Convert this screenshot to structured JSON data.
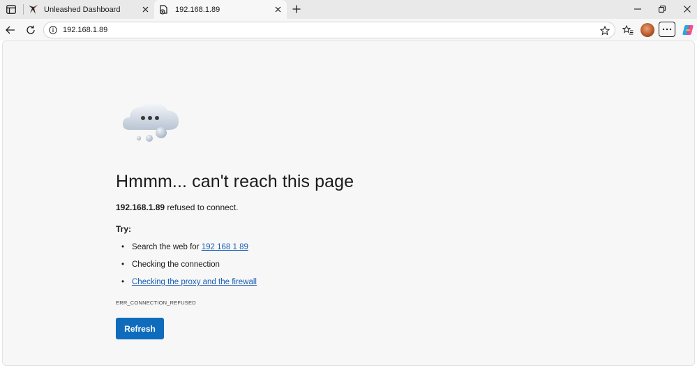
{
  "tabs": [
    {
      "title": "Unleashed Dashboard",
      "active": false
    },
    {
      "title": "192.168.1.89",
      "active": true
    }
  ],
  "address_bar": {
    "url": "192.168.1.89"
  },
  "error_page": {
    "headline": "Hmmm... can't reach this page",
    "host": "192.168.1.89",
    "message": " refused to connect.",
    "try_label": "Try:",
    "suggestions": {
      "search_prefix": "Search the web for ",
      "search_link": "192 168 1 89",
      "check_connection": "Checking the connection",
      "check_proxy": "Checking the proxy and the firewall"
    },
    "error_code": "ERR_CONNECTION_REFUSED",
    "refresh_label": "Refresh"
  },
  "colors": {
    "accent": "#0f6cbd",
    "link": "#1a5fb4",
    "page_bg": "#f7f7f7",
    "tabbar_bg": "#e9e9e9"
  },
  "icons": [
    "tab-actions-icon",
    "unleashed-favicon",
    "page-error-favicon",
    "close-icon",
    "new-tab-icon",
    "minimize-icon",
    "restore-icon",
    "back-arrow-icon",
    "refresh-icon",
    "info-icon",
    "star-icon",
    "favorites-icon",
    "avatar",
    "more-icon",
    "copilot-icon",
    "cloud-illustration"
  ]
}
